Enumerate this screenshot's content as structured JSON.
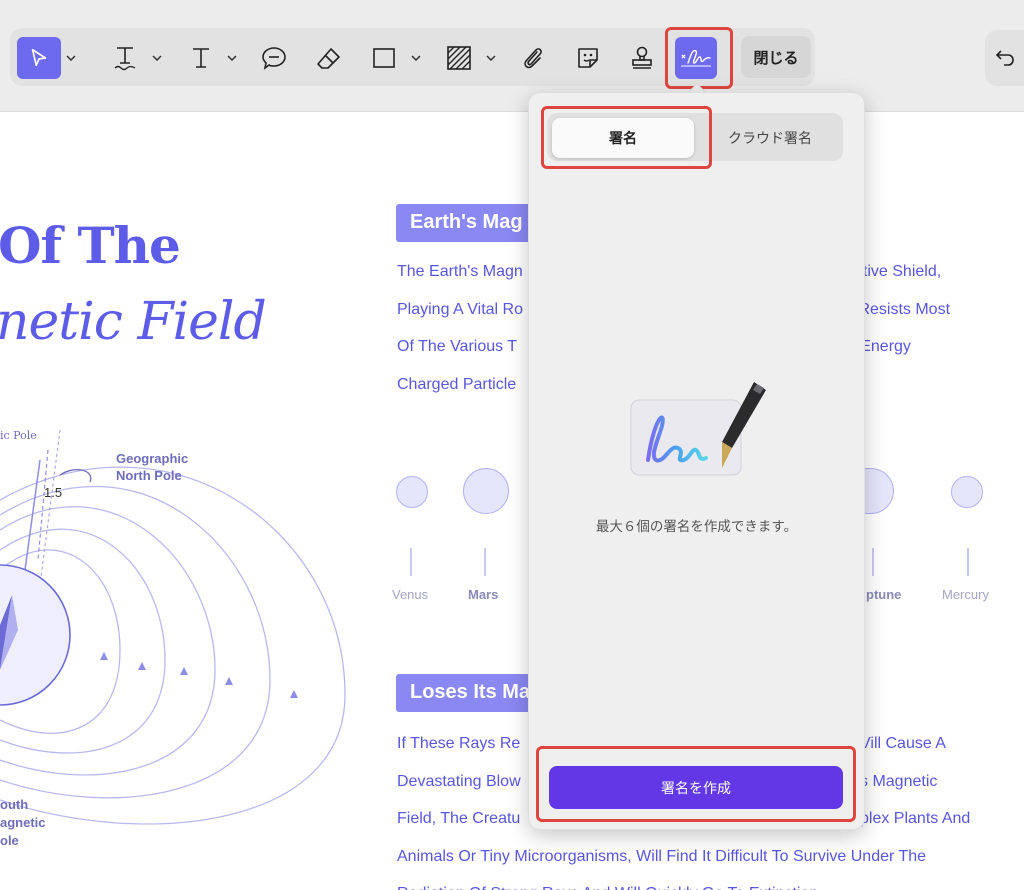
{
  "toolbar": {
    "close_label": "閉じる",
    "tools": [
      "select-tool",
      "text-tool",
      "text-box-tool",
      "comment-tool",
      "eraser-tool",
      "rectangle-tool",
      "pattern-fill-tool",
      "attachment-tool",
      "sticker-tool",
      "stamp-tool",
      "signature-tool"
    ],
    "accent_color": "#6e6af0",
    "highlight_color": "#e0453f"
  },
  "document": {
    "title_line1": "Of The",
    "title_line2": "netic Field",
    "section1_heading": "Earth's Mag",
    "section1_paragraph": [
      "The Earth's Magn",
      "Playing A Vital Ro",
      "Of The Various T",
      "Charged Particle"
    ],
    "section1_paragraph_right": [
      "ective Shield,",
      "y Resists Most",
      "h-Energy"
    ],
    "planets": [
      "Venus",
      "Mars",
      "ptune",
      "Mercury"
    ],
    "section2_heading": "Loses Its Ma",
    "section2_paragraph": [
      "If These Rays Re",
      "Devastating Blow",
      "Field, The Creatu",
      "Animals Or Tiny Microorganisms, Will Find It Difficult To Survive Under The",
      "Radiation Of Strong Rays And Will Quickly Go To Extinction"
    ],
    "section2_paragraph_right": [
      "Vill Cause A",
      "s Magnetic",
      "plex Plants And"
    ],
    "diagram": {
      "pole_label": "ic Pole",
      "angle_label": "1.5",
      "north_label_1": "Geographic",
      "north_label_2": "North Pole",
      "south_label_1": "outh",
      "south_label_2": "agnetic",
      "south_label_3": "ole"
    },
    "text_color": "#5856df",
    "heading_bg": "#8a88f2"
  },
  "signature_popup": {
    "tabs": [
      {
        "label": "署名",
        "selected": true
      },
      {
        "label": "クラウド署名",
        "selected": false
      }
    ],
    "info_text": "最大６個の署名を作成できます。",
    "create_button_label": "署名を作成",
    "button_color": "#6237e6"
  }
}
